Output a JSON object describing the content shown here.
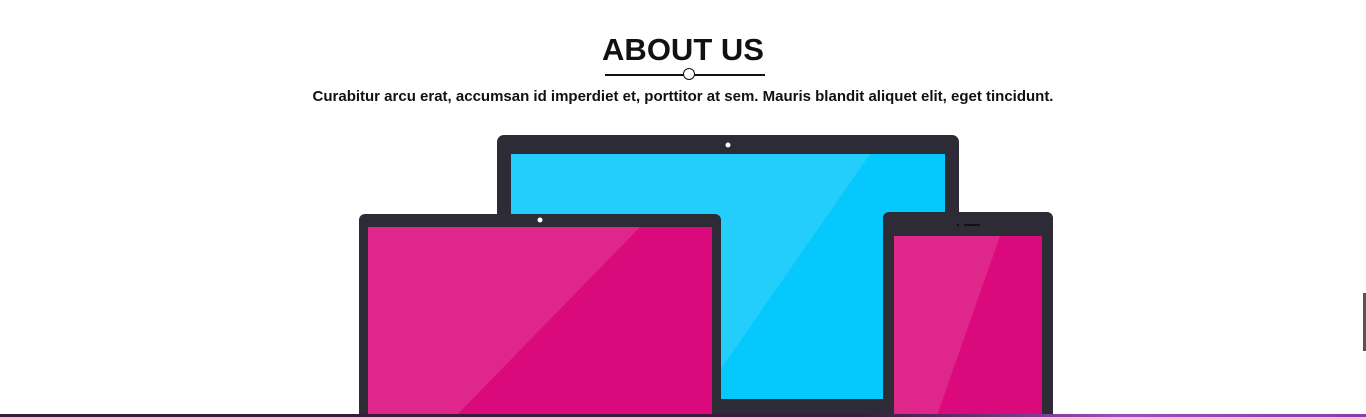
{
  "about": {
    "title": "ABOUT US",
    "subtitle": "Curabitur arcu erat, accumsan id imperdiet et, porttitor at sem. Mauris blandit aliquet elit, eget tincidunt."
  },
  "illustration": {
    "devices": [
      "monitor",
      "laptop",
      "tablet"
    ],
    "colors": {
      "frame": "#2d2c36",
      "monitor_screen": "#05c8fc",
      "laptop_screen": "#db0a7c",
      "tablet_screen": "#db0a7c"
    }
  },
  "icons": {
    "divider_ornament": "circle-icon",
    "monitor_camera": "camera-dot-icon",
    "laptop_camera": "camera-dot-icon",
    "tablet_speaker": "speaker-slot-icon"
  }
}
